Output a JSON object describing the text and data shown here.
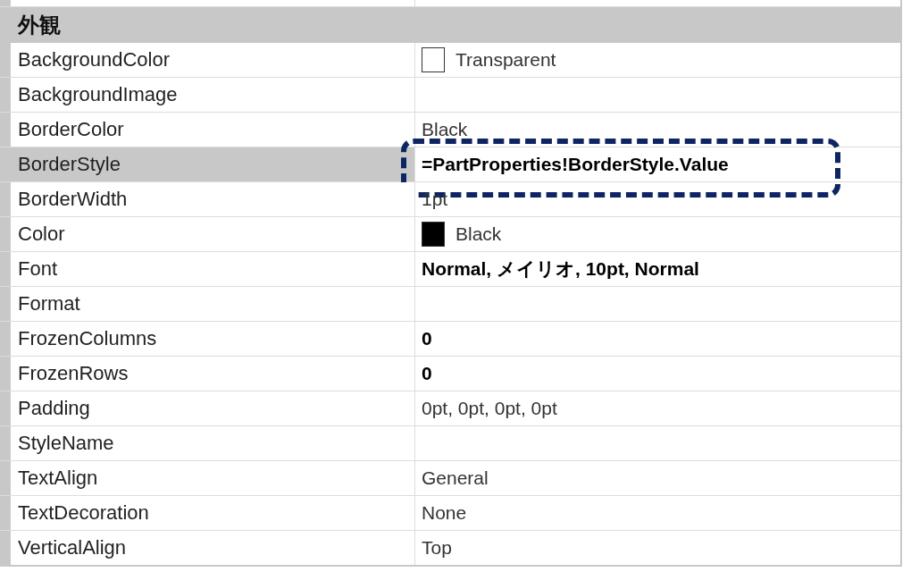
{
  "section": {
    "title": "外観"
  },
  "rows": [
    {
      "name": "BackgroundColor",
      "value": "Transparent",
      "color": "#ffffff",
      "bold": false,
      "selected": false,
      "highlighted": false
    },
    {
      "name": "BackgroundImage",
      "selected": false,
      "highlighted": false
    },
    {
      "name": "BorderColor",
      "value": "Black",
      "bold": false,
      "selected": false,
      "highlighted": false
    },
    {
      "name": "BorderStyle",
      "value": "=PartProperties!BorderStyle.Value",
      "bold": true,
      "selected": true,
      "highlighted": true
    },
    {
      "name": "BorderWidth",
      "value": "1pt",
      "bold": false,
      "selected": false,
      "highlighted": false
    },
    {
      "name": "Color",
      "value": "Black",
      "color": "#000000",
      "bold": false,
      "selected": false,
      "highlighted": false
    },
    {
      "name": "Font",
      "value": "Normal, メイリオ, 10pt, Normal",
      "bold": true,
      "selected": false,
      "highlighted": false
    },
    {
      "name": "Format",
      "selected": false,
      "highlighted": false
    },
    {
      "name": "FrozenColumns",
      "value": "0",
      "bold": true,
      "selected": false,
      "highlighted": false
    },
    {
      "name": "FrozenRows",
      "value": "0",
      "bold": true,
      "selected": false,
      "highlighted": false
    },
    {
      "name": "Padding",
      "value": "0pt, 0pt, 0pt, 0pt",
      "bold": false,
      "selected": false,
      "highlighted": false
    },
    {
      "name": "StyleName",
      "selected": false,
      "highlighted": false
    },
    {
      "name": "TextAlign",
      "value": "General",
      "bold": false,
      "selected": false,
      "highlighted": false
    },
    {
      "name": "TextDecoration",
      "value": "None",
      "bold": false,
      "selected": false,
      "highlighted": false
    },
    {
      "name": "VerticalAlign",
      "value": "Top",
      "bold": false,
      "selected": false,
      "highlighted": false
    }
  ]
}
